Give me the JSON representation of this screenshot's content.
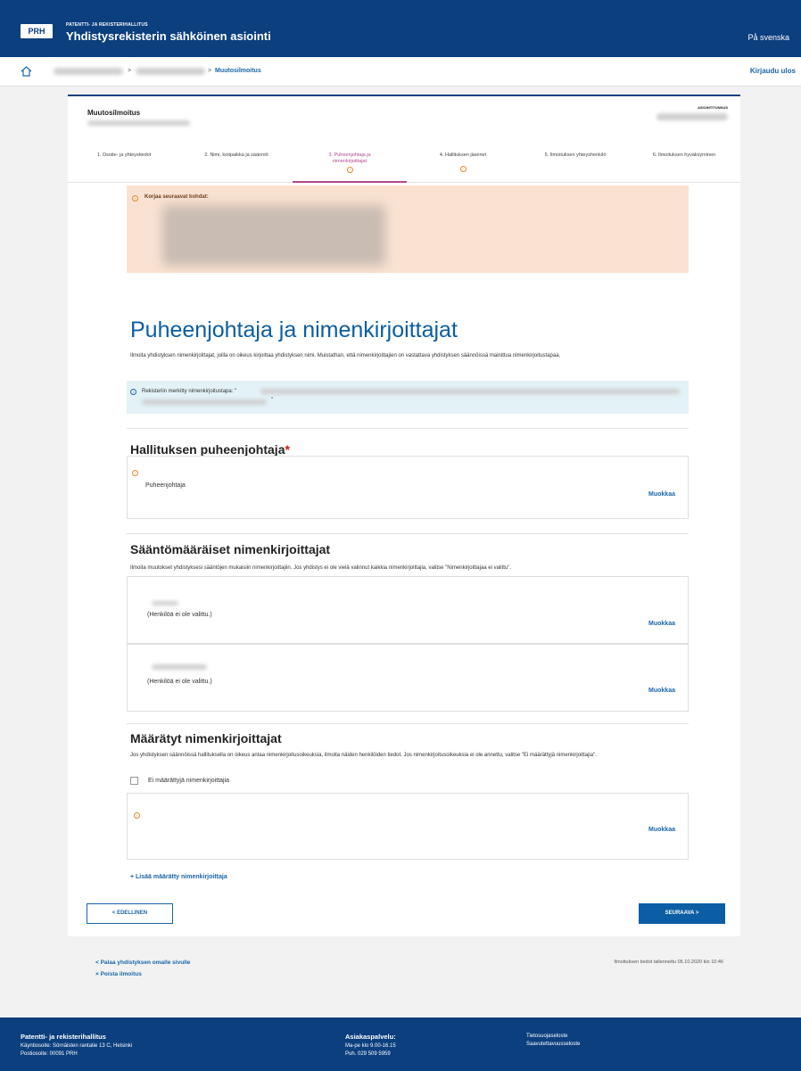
{
  "header": {
    "logo": "PRH",
    "org": "PATENTTI- JA REKISTERIHALLITUS",
    "title": "Yhdistysrekisterin sähköinen asiointi",
    "lang": "På svenska"
  },
  "breadcrumb": {
    "sep1": ">",
    "sep2": ">",
    "current": "Muutosilmoitus",
    "logout": "Kirjaudu ulos"
  },
  "card": {
    "title": "Muutosilmoitus",
    "case_label": "ASIOINTITUNNUS"
  },
  "steps": [
    {
      "label": "1. Osoite- ja yhteystiedot"
    },
    {
      "label": "2. Nimi, kotipaikka ja säännöt"
    },
    {
      "label": "3. Puheenjohtaja ja nimenkirjoittajat"
    },
    {
      "label": "4. Hallituksen jäsenet"
    },
    {
      "label": "5. Ilmoituksen yhteyshenkilö"
    },
    {
      "label": "6. Ilmoituksen hyväksyminen"
    }
  ],
  "error": {
    "title": "Korjaa seuraavat kohdat:"
  },
  "page_title": "Puheenjohtaja ja nimenkirjoittajat",
  "intro": "Ilmoita yhdistyksen nimenkirjoittajat, joilla on oikeus kirjoittaa yhdistyksen nimi. Muistathan, että nimenkirjoittajien on vastattava yhdistyksen säännöissä mainittua nimenkirjoitustapaa.",
  "info": {
    "label": "Rekisteriin merkitty nimenkirjoitustapa: \"",
    "end": "\""
  },
  "chair": {
    "heading": "Hallituksen puheenjohtaja",
    "required": "*",
    "role": "Puheenjohtaja",
    "edit": "Muokkaa"
  },
  "signatories": {
    "heading": "Sääntömääräiset nimenkirjoittajat",
    "desc": "Ilmoita muutokset yhdistyksesi sääntöjen mukaisiin nimenkirjoittajiin. Jos yhdistys ei ole vielä valinnut kaikkia nimenkirjoittajia, valitse \"Nimenkirjoittajaa ei valittu\".",
    "items": [
      {
        "status": "(Henkilöä ei ole valittu.)",
        "edit": "Muokkaa"
      },
      {
        "status": "(Henkilöä ei ole valittu.)",
        "edit": "Muokkaa"
      }
    ]
  },
  "appointed": {
    "heading": "Määrätyt nimenkirjoittajat",
    "desc": "Jos yhdistyksen säännöissä hallituksella on oikeus antaa nimenkirjoitusoikeuksia, ilmoita näiden henkilöiden tiedot. Jos nimenkirjoitusoikeuksia ei ole annettu, valitse \"Ei määrättyjä nimenkirjoittajia\".",
    "checkbox_label": "Ei määrättyjä nimenkirjoittajia",
    "edit": "Muokkaa",
    "add": "+ Lisää määrätty nimenkirjoittaja"
  },
  "nav": {
    "prev": "< EDELLINEN",
    "next": "SEURAAVA >"
  },
  "links": {
    "back": "< Palaa yhdistyksen omalle sivulle",
    "delete": "× Poista ilmoitus",
    "saved": "Ilmoituksen tiedot tallennettu 05.10.2020 klo 10:46"
  },
  "footer": {
    "col1": {
      "title": "Patentti- ja rekisterihallitus",
      "line1": "Käyntiosoite: Sörnäisten rantatie 13 C, Helsinki",
      "line2": "Postiosoite: 00091 PRH"
    },
    "col2": {
      "title": "Asiakaspalvelu:",
      "line1": "Ma-pe klo 9.00-16.15",
      "line2": "Puh. 029 509 5959"
    },
    "col3": {
      "line1": "Tietosuojaseloste",
      "line2": "Saavutettavuusseloste"
    }
  }
}
